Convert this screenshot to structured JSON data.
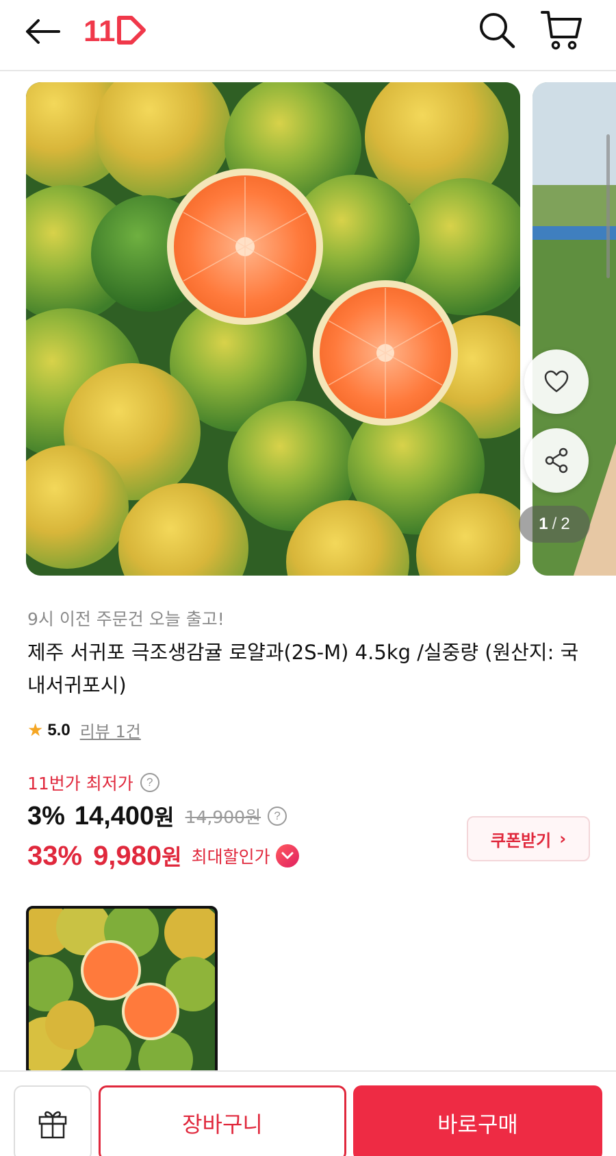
{
  "header": {
    "logo_text": "11",
    "brand_color": "#f0384a"
  },
  "carousel": {
    "current": "1",
    "separator": "/",
    "total": "2"
  },
  "product": {
    "shipping_notice": "9시 이전 주문건 오늘 출고!",
    "title": "제주 서귀포 극조생감귤 로얄과(2S-M) 4.5kg /실중량 (원산지: 국내서귀포시)",
    "rating": {
      "star": "★",
      "score": "5.0",
      "reviews_label": "리뷰 1건"
    }
  },
  "pricing": {
    "lowest_label": "11번가 최저가",
    "help_icon": "?",
    "discount_pct": "3%",
    "price": "14,400",
    "won": "원",
    "original_price": "14,900원",
    "max_discount_pct": "33%",
    "max_price": "9,980",
    "max_label": "최대할인가",
    "coupon_button": "쿠폰받기",
    "coupon_arrow": "›"
  },
  "bottom_bar": {
    "cart_button": "장바구니",
    "buy_button": "바로구매"
  },
  "colors": {
    "accent_red": "#e0283c",
    "buy_red": "#ee2b44"
  },
  "icons": [
    "back-arrow-icon",
    "search-icon",
    "cart-icon",
    "heart-icon",
    "share-icon",
    "gift-icon",
    "chevron-down-icon"
  ]
}
